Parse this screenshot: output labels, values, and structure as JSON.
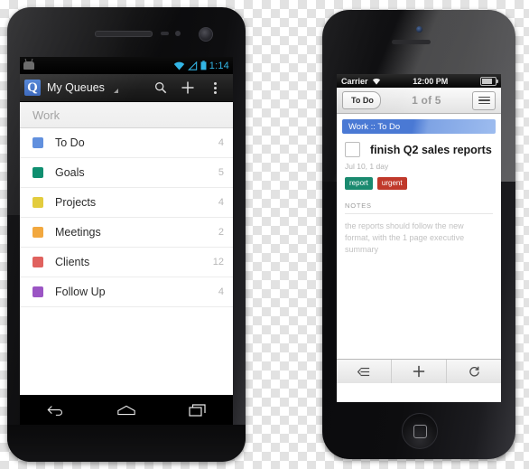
{
  "android": {
    "status_bar": {
      "notification_icon": "android-robot-icon",
      "wifi_icon": "wifi-icon",
      "signal_icon": "signal-icon",
      "battery_icon": "battery-icon",
      "clock": "1:14"
    },
    "app_bar": {
      "logo_letter": "Q",
      "title": "My Queues",
      "dropdown_icon": "chevron-down-icon",
      "search_icon": "search-icon",
      "add_icon": "plus-icon",
      "overflow_icon": "overflow-menu-icon"
    },
    "section_header": "Work",
    "queues": [
      {
        "label": "To Do",
        "count": "4",
        "color": "#6190de"
      },
      {
        "label": "Goals",
        "count": "5",
        "color": "#0f8f70"
      },
      {
        "label": "Projects",
        "count": "4",
        "color": "#e3cc3e"
      },
      {
        "label": "Meetings",
        "count": "2",
        "color": "#f2a83f"
      },
      {
        "label": "Clients",
        "count": "12",
        "color": "#e0625e"
      },
      {
        "label": "Follow Up",
        "count": "4",
        "color": "#9b55c4"
      }
    ],
    "nav_bar": {
      "back_icon": "back-arrow-icon",
      "home_icon": "home-icon",
      "recents_icon": "recent-apps-icon"
    }
  },
  "iphone": {
    "status_bar": {
      "carrier": "Carrier",
      "wifi_icon": "wifi-icon",
      "time": "12:00 PM",
      "battery_icon": "battery-icon"
    },
    "nav_bar": {
      "back_label": "To Do",
      "title": "1 of 5",
      "menu_icon": "hamburger-menu-icon"
    },
    "breadcrumb": "Work :: To Do",
    "task": {
      "checkbox": "unchecked-checkbox-icon",
      "name": "finish Q2 sales reports",
      "due": "Jul 10, 1 day",
      "tags": [
        {
          "label": "report",
          "color": "#1a8a6f"
        },
        {
          "label": "urgent",
          "color": "#c0392b"
        }
      ]
    },
    "notes": {
      "header": "NOTES",
      "body": "the reports should follow the new format, with the 1 page executive summary"
    },
    "toolbar": {
      "list_icon": "list-indent-icon",
      "add_icon": "plus-icon",
      "refresh_icon": "refresh-icon"
    },
    "home_button_icon": "home-button-icon"
  }
}
